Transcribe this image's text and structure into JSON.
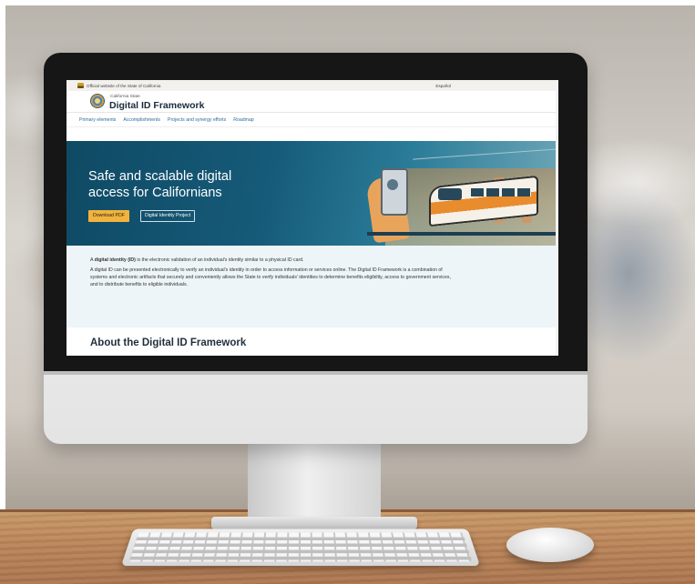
{
  "site": {
    "gov_banner": "Official website of the State of California",
    "language": "Español",
    "kicker": "California State",
    "title": "Digital ID Framework"
  },
  "nav": {
    "items": [
      "Primary elements",
      "Accomplishments",
      "Projects and synergy efforts",
      "Roadmap"
    ]
  },
  "hero": {
    "heading": "Safe and scalable digital access for Californians",
    "primary_button": "Download PDF",
    "secondary_button": "Digital Identity Project"
  },
  "content": {
    "p1_bold": "digital identity (ID)",
    "p1_pre": "A ",
    "p1_post": " is the electronic validation of an individual's identity similar to a physical ID card.",
    "p2": "A digital ID can be presented electronically to verify an individual's identity in order to access information or services online. The Digital ID Framework is a combination of systems and electronic artifacts that securely and conveniently allows the State to verify individuals' identities to determine benefits eligibility, access to government services, and to distribute benefits to eligible individuals.",
    "section_heading": "About the Digital ID Framework"
  },
  "colors": {
    "hero_bg": "#155a78",
    "primary_button": "#f2b33d",
    "nav_link": "#2c6aa0"
  }
}
